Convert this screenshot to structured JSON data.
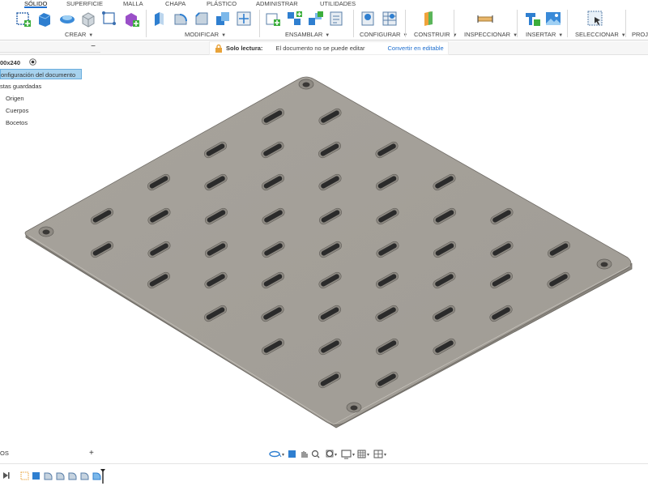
{
  "toolbar": {
    "tabs": [
      "SÓLIDO",
      "SUPERFICIE",
      "MALLA",
      "CHAPA",
      "PLÁSTICO",
      "ADMINISTRAR",
      "UTILIDADES"
    ],
    "groups": {
      "crear": "CREAR",
      "modificar": "MODIFICAR",
      "ensamblar": "ENSAMBLAR",
      "configurar": "CONFIGURAR",
      "construir": "CONSTRUIR",
      "inspeccionar": "INSPECCIONAR",
      "insertar": "INSERTAR",
      "seleccionar": "SELECCIONAR",
      "proyectar": "PROJE"
    },
    "accent": "#1f6fcf"
  },
  "readonly_bar": {
    "label": "Solo lectura:",
    "message": "El documento no se puede editar",
    "action": "Convertir en editable"
  },
  "browser": {
    "doc_name": "00x240",
    "items": [
      {
        "label": "onfiguración del documento",
        "selected": true
      },
      {
        "label": "stas guardadas",
        "selected": false
      },
      {
        "label": "Origen",
        "selected": false
      },
      {
        "label": "Cuerpos",
        "selected": false
      },
      {
        "label": "Bocetos",
        "selected": false
      }
    ],
    "collapse": "−"
  },
  "sketch_panel": {
    "label": "OS",
    "add": "+"
  },
  "model": {
    "plate_color": "#a9a59e",
    "slot_color": "#2b2b2b"
  }
}
